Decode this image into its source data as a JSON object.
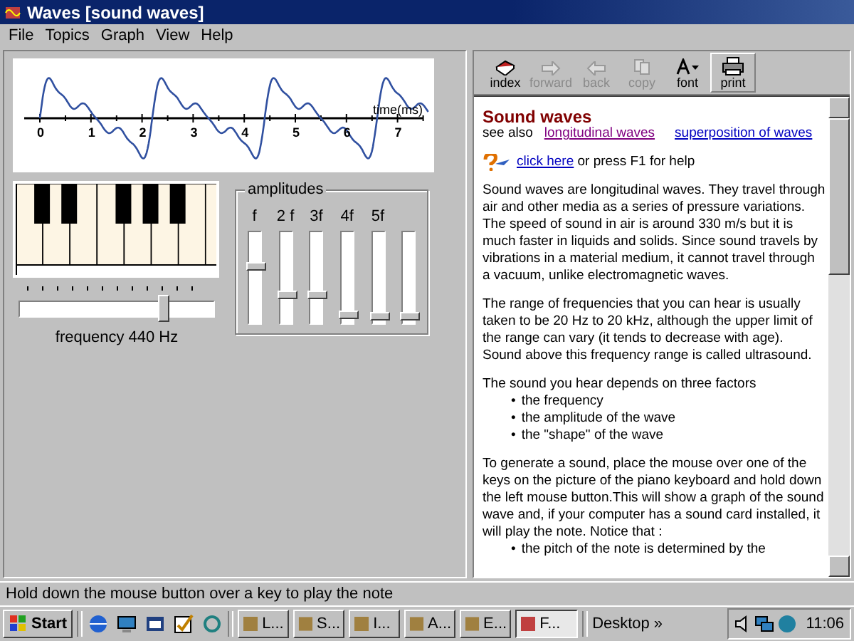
{
  "window": {
    "title": "Waves [sound waves]"
  },
  "menu": [
    "File",
    "Topics",
    "Graph",
    "View",
    "Help"
  ],
  "graph": {
    "axis_label": "time(ms)",
    "x_labels": [
      "0",
      "1",
      "2",
      "3",
      "4",
      "5",
      "6",
      "7"
    ]
  },
  "frequency": {
    "label": "frequency 440 Hz",
    "level": 0.74
  },
  "amplitudes": {
    "title": "amplitudes",
    "sliders": [
      {
        "label": "f",
        "level": 0.62
      },
      {
        "label": "2 f",
        "level": 0.31
      },
      {
        "label": "3f",
        "level": 0.31
      },
      {
        "label": "4f",
        "level": 0.09
      },
      {
        "label": "5f",
        "level": 0.08
      },
      {
        "level": 0.08
      }
    ]
  },
  "toolbar": [
    {
      "label": "index",
      "kind": "book",
      "disabled": false
    },
    {
      "label": "forward",
      "kind": "forward",
      "disabled": true
    },
    {
      "label": "back",
      "kind": "back",
      "disabled": true
    },
    {
      "label": "copy",
      "kind": "copy",
      "disabled": true
    },
    {
      "label": "font",
      "kind": "font",
      "disabled": false
    },
    {
      "label": "print",
      "kind": "print",
      "disabled": false
    }
  ],
  "help": {
    "heading": "Sound waves",
    "see_also": "see also",
    "links": [
      {
        "text": "longitudinal waves",
        "visited": true
      },
      {
        "text": "superposition of waves",
        "visited": false
      }
    ],
    "help_link": "click here",
    "help_text": "or press F1 for help",
    "blocks": [
      {
        "kind": "paragraph",
        "text": "Sound waves are longitudinal waves. They travel through air and other media as a series of pressure variations. The speed of sound in air is around 330 m/s but it is much faster in liquids and solids. Since sound travels by vibrations in a material medium, it cannot travel through a vacuum, unlike electromagnetic waves."
      },
      {
        "kind": "paragraph",
        "text": "The range of frequencies that you can hear is usually taken to be 20 Hz to 20 kHz, although the upper limit of the range can vary (it tends to decrease with age). Sound above this frequency range is called ultrasound."
      },
      {
        "kind": "paragraph",
        "text": "The sound you hear depends on three factors"
      },
      {
        "kind": "bullets",
        "marker": "•",
        "items": [
          "the frequency",
          "the amplitude of the wave",
          "the \"shape\" of the wave"
        ]
      },
      {
        "kind": "paragraph",
        "text": "To generate a sound, place the mouse over one of the keys on the picture of the piano keyboard and hold down the left mouse button.This will show a graph of the sound wave and, if your computer has a sound card installed, it will play the note. Notice that :"
      },
      {
        "kind": "bullets",
        "marker": "•",
        "items": [
          "the pitch of the note is determined by the"
        ]
      }
    ]
  },
  "status_bar": "Hold down the mouse button over a key to play the note",
  "taskbar": {
    "start": "Start",
    "tasks": [
      {
        "label": "L...",
        "selected": false
      },
      {
        "label": "S...",
        "selected": false
      },
      {
        "label": "I...",
        "selected": false
      },
      {
        "label": "A...",
        "selected": false
      },
      {
        "label": "E...",
        "selected": false
      },
      {
        "label": "F...",
        "selected": true
      }
    ],
    "desktop": "Desktop",
    "chevron": "»",
    "clock": "11:06"
  }
}
